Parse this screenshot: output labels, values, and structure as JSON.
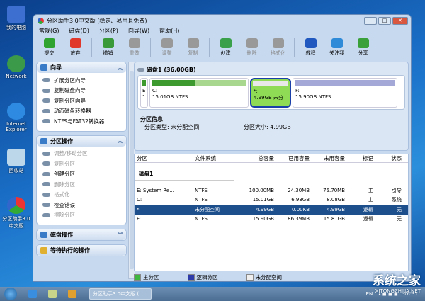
{
  "desktop": [
    "我的电脑",
    "Network",
    "Internet Explorer",
    "回收站",
    "分区助手3.0中文版"
  ],
  "window": {
    "title": "分区助手3.0中文版 (稳定、易用且免费)"
  },
  "menu": [
    "常规(G)",
    "磁盘(D)",
    "分区(P)",
    "向导(W)",
    "帮助(H)"
  ],
  "toolbar": [
    {
      "label": "提交",
      "color": "#2fa32f"
    },
    {
      "label": "放弃",
      "color": "#e0392c"
    },
    {
      "label": "撤销",
      "color": "#3a9a3a"
    },
    {
      "label": "重做",
      "disabled": true
    },
    {
      "label": "调整",
      "disabled": true
    },
    {
      "label": "复制",
      "disabled": true
    },
    {
      "label": "创建",
      "color": "#3aa04a"
    },
    {
      "label": "删除",
      "disabled": true
    },
    {
      "label": "格式化",
      "disabled": true
    },
    {
      "label": "教程",
      "color": "#2058c0"
    },
    {
      "label": "关注我",
      "color": "#2f8ad8"
    },
    {
      "label": "分享",
      "color": "#3aa03a"
    }
  ],
  "sidebar": {
    "wizard": {
      "title": "向导",
      "items": [
        "扩展分区向导",
        "复制磁盘向导",
        "复制分区向导",
        "动态磁盘转换器",
        "NTFS与FAT32转换器"
      ]
    },
    "partition_ops": {
      "title": "分区操作",
      "items": [
        {
          "label": "调整/移动分区",
          "disabled": true
        },
        {
          "label": "复制分区",
          "disabled": true
        },
        {
          "label": "创建分区"
        },
        {
          "label": "删除分区",
          "disabled": true
        },
        {
          "label": "格式化",
          "disabled": true
        },
        {
          "label": "检查错误"
        },
        {
          "label": "擦除分区",
          "disabled": true
        }
      ]
    },
    "disk_ops": {
      "title": "磁盘操作"
    },
    "pending": {
      "title": "等待执行的操作"
    }
  },
  "disk": {
    "title": "磁盘1 (36.00GB)",
    "map": [
      {
        "name": "E",
        "sub": "1",
        "used": 1
      },
      {
        "name": "C:",
        "sub": "15.01GB NTFS",
        "used": 0.46
      },
      {
        "name": "*:",
        "sub": "4.99GB 未分"
      },
      {
        "name": "F:",
        "sub": "15.90GB NTFS"
      }
    ],
    "info_title": "分区信息",
    "type_label": "分区类型: 未分配空间",
    "size_label": "分区大小: 4.99GB"
  },
  "table": {
    "headers": [
      "分区",
      "文件系统",
      "总容量",
      "已用容量",
      "未用容量",
      "标记",
      "状态"
    ],
    "group": "磁盘1",
    "rows": [
      [
        "E:  System Re...",
        "NTFS",
        "100.00MB",
        "24.30MB",
        "75.70MB",
        "主",
        "引导"
      ],
      [
        "C:",
        "NTFS",
        "15.01GB",
        "6.93GB",
        "8.08GB",
        "主",
        "系统"
      ],
      [
        "*",
        "未分配空间",
        "4.99GB",
        "0.00KB",
        "4.99GB",
        "逻辑",
        "无"
      ],
      [
        "F:",
        "NTFS",
        "15.90GB",
        "86.39MB",
        "15.81GB",
        "逻辑",
        "无"
      ]
    ]
  },
  "legend": [
    "主分区",
    "逻辑分区",
    "未分配空间"
  ],
  "taskbar": {
    "task": "分区助手3.0中文版 (...",
    "lang": "EN",
    "time": "16:31"
  },
  "watermark": {
    "main": "系统之家",
    "sub": "XITONGZHIJIA.NET"
  }
}
